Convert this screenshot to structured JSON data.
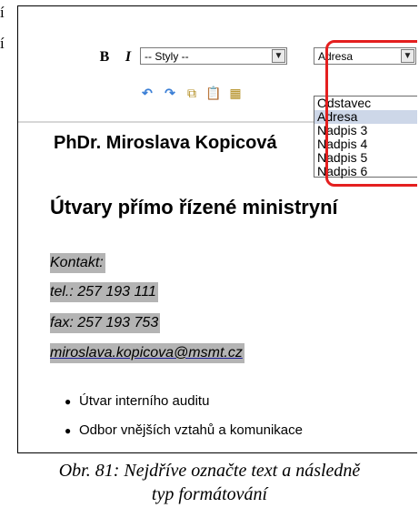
{
  "side_chars": [
    "í",
    "í"
  ],
  "toolbar": {
    "bold_label": "B",
    "italic_label": "I",
    "styles_combo_value": "-- Styly --",
    "format_combo_value": "Adresa",
    "format_options": [
      "Odstavec",
      "Adresa",
      "Nadpis 3",
      "Nadpis 4",
      "Nadpis 5",
      "Nadpis 6"
    ],
    "selected_option": "Adresa",
    "icons": [
      "undo-icon",
      "redo-icon",
      "copy-icon",
      "paste-icon",
      "paste-word-icon"
    ],
    "highlight_color": "#e41f1f"
  },
  "editor": {
    "name_heading": "PhDr. Miroslava Kopicová",
    "section_heading": "Útvary přímo řízené ministryní",
    "contact": [
      "Kontakt:",
      "tel.: 257 193 111",
      "fax: 257 193 753"
    ],
    "email": "miroslava.kopicova@msmt.cz",
    "list_items": [
      "Útvar interního auditu",
      "Odbor vnějších vztahů a komunikace"
    ]
  },
  "caption": {
    "line1": "Obr. 81: Nejdříve označte text a následně",
    "line2": "typ formátování"
  }
}
